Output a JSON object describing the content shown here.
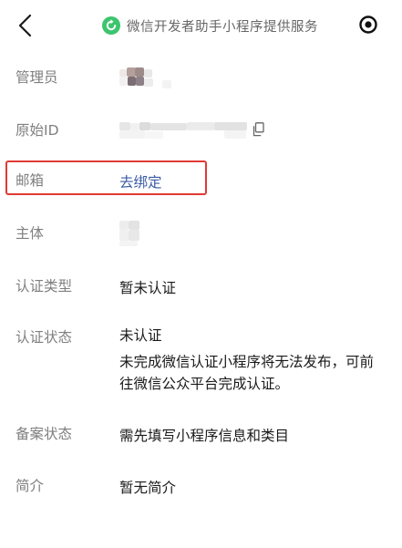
{
  "topbar": {
    "provider_text": "微信开发者助手小程序提供服务",
    "accent_color": "#3cc56e",
    "back_icon": "chevron-left-icon",
    "provider_icon": "refresh-circle-icon",
    "menu_icon": "target-icon"
  },
  "fields": {
    "admin": {
      "label": "管理员"
    },
    "original_id": {
      "label": "原始ID",
      "copy_icon": "copy-icon"
    },
    "email": {
      "label": "邮箱",
      "value": "去绑定"
    },
    "subject": {
      "label": "主体"
    },
    "cert_type": {
      "label": "认证类型",
      "value": "暂未认证"
    },
    "cert_status": {
      "label": "认证状态",
      "value": "未认证",
      "note": "未完成微信认证小程序将无法发布，可前往微信公众平台完成认证。"
    },
    "record_status": {
      "label": "备案状态",
      "value": "需先填写小程序信息和类目"
    },
    "intro": {
      "label": "简介",
      "value": "暂无简介"
    }
  },
  "colors": {
    "label": "#7f7f7f",
    "link": "#3a5ba3",
    "highlight_border": "#e03a35"
  }
}
